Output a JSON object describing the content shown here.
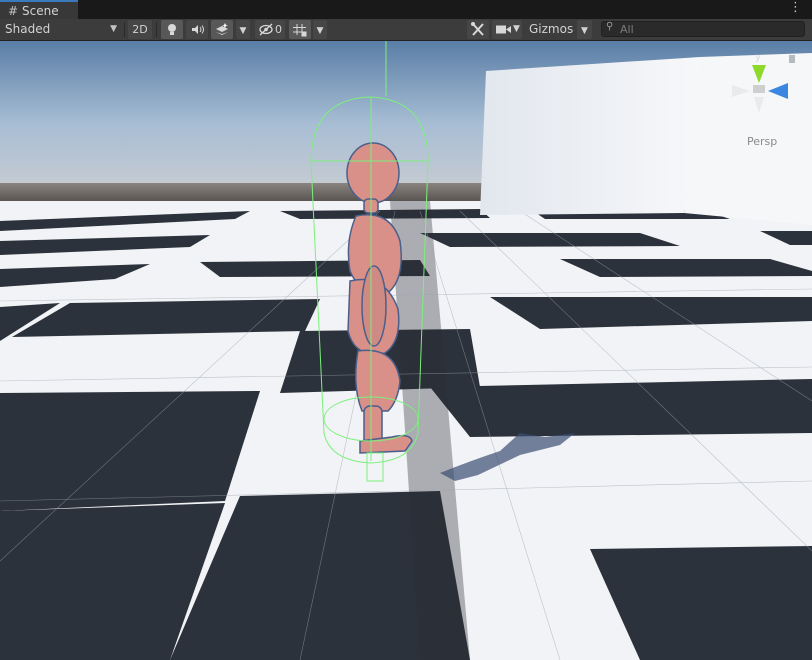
{
  "tab": {
    "icon": "hash-icon",
    "label": "Scene",
    "menu_icon": "kebab-menu-icon"
  },
  "toolbar": {
    "draw_mode": "Shaded",
    "mode_2d": "2D",
    "hidden_count": "0",
    "gizmos": "Gizmos",
    "search_placeholder": "All",
    "icons": [
      "lightbulb-icon",
      "audio-icon",
      "effects-icon",
      "visibility-icon",
      "grid-icon",
      "tools-icon",
      "camera-icon",
      "search-icon"
    ]
  },
  "viewport": {
    "projection": "Persp",
    "axes": {
      "y": "y"
    },
    "colors": {
      "selection": "#7cf07c",
      "y_axis": "#8fd92b",
      "z_axis": "#3a86e0",
      "sky": "#a8bfd7",
      "floor_dark": "#2c323b"
    }
  }
}
